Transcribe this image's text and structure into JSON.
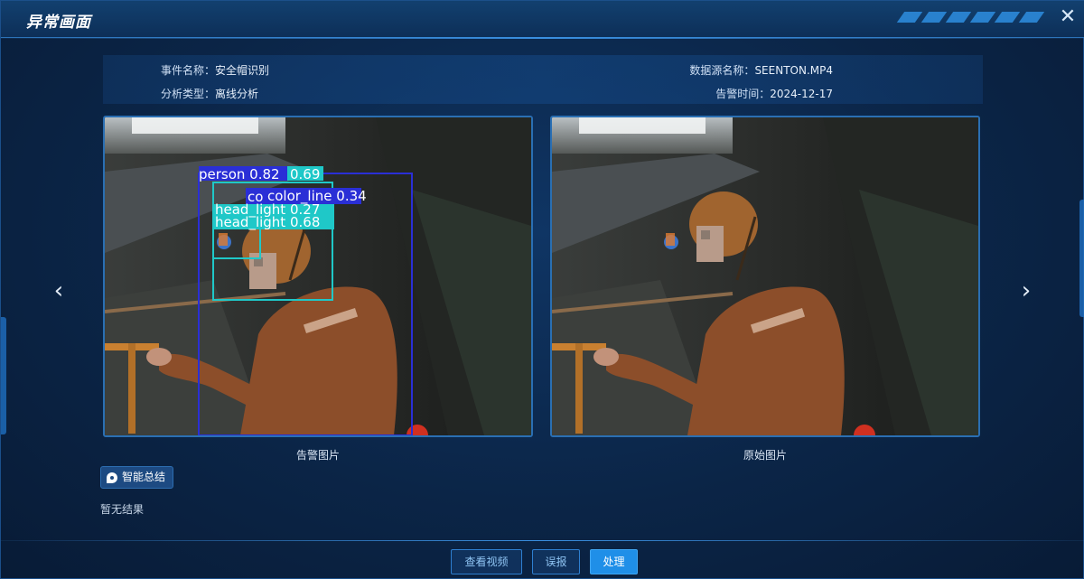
{
  "window": {
    "title": "异常画面",
    "close_icon": "close-icon"
  },
  "info": {
    "event_name_label": "事件名称：",
    "event_name_value": "安全帽识别",
    "analysis_type_label": "分析类型：",
    "analysis_type_value": "离线分析",
    "datasource_label": "数据源名称：",
    "datasource_value": "SEENTON.MP4",
    "alarm_time_label": "告警时间：",
    "alarm_time_value": "2024-12-17"
  },
  "images": {
    "alarm_caption": "告警图片",
    "original_caption": "原始图片",
    "detections": [
      {
        "label": "person 0.82",
        "color": "#2a2fd6"
      },
      {
        "label": "0.69",
        "color": "#1fc8c8"
      },
      {
        "label": "co",
        "color": "#2a2fd6"
      },
      {
        "label": "color_line 0.34",
        "color": "#2a2fd6"
      },
      {
        "label": "head_light 0.27",
        "color": "#1fc8c8"
      },
      {
        "label": "head_light 0.68",
        "color": "#1fc8c8"
      }
    ]
  },
  "summary": {
    "badge_label": "智能总结",
    "icon": "chat-bubble-icon",
    "result_text": "暂无结果"
  },
  "buttons": {
    "view_video": "查看视频",
    "false_report": "误报",
    "handle": "处理"
  },
  "nav": {
    "prev_icon": "chevron-left-icon",
    "next_icon": "chevron-right-icon"
  },
  "colors": {
    "accent": "#1f8fe8",
    "border": "#2a6fb3",
    "background": "#0b2547"
  }
}
